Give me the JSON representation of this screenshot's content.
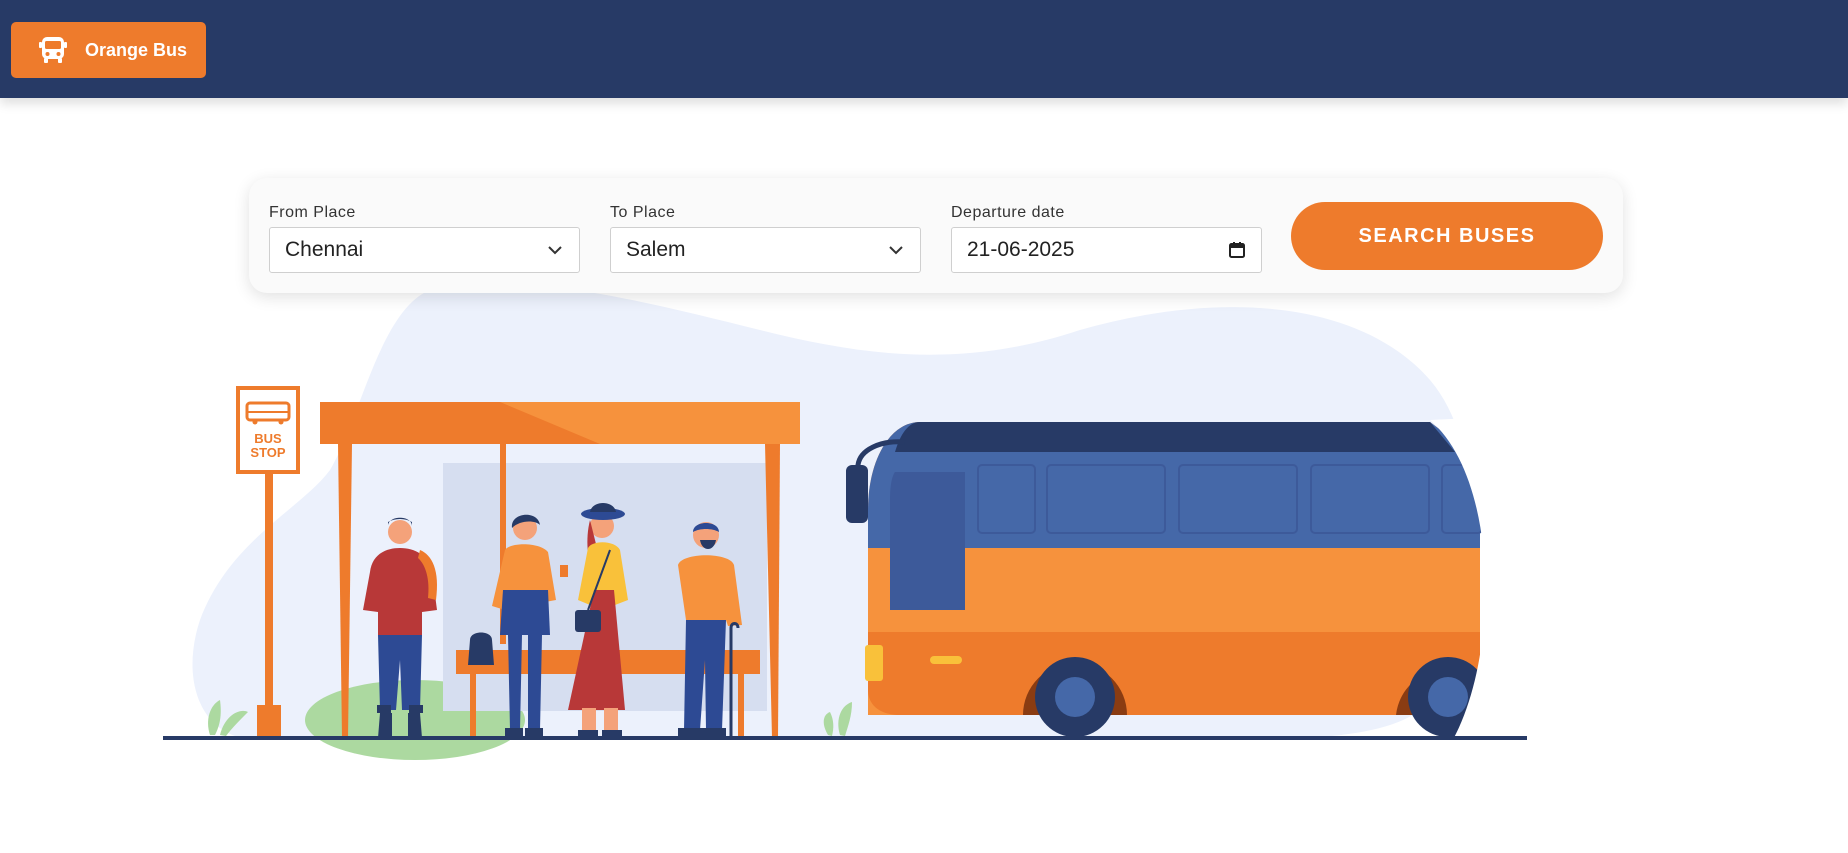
{
  "header": {
    "brand_label": "Orange Bus",
    "brand_icon": "bus-icon",
    "bg_color": "#273a66",
    "accent_color": "#ee7b2c"
  },
  "search": {
    "from": {
      "label": "From Place",
      "value": "Chennai"
    },
    "to": {
      "label": "To Place",
      "value": "Salem"
    },
    "date": {
      "label": "Departure date",
      "value": "21-06-2025"
    },
    "button_label": "SEARCH BUSES"
  },
  "illustration": {
    "sign_line1": "BUS",
    "sign_line2": "STOP"
  }
}
